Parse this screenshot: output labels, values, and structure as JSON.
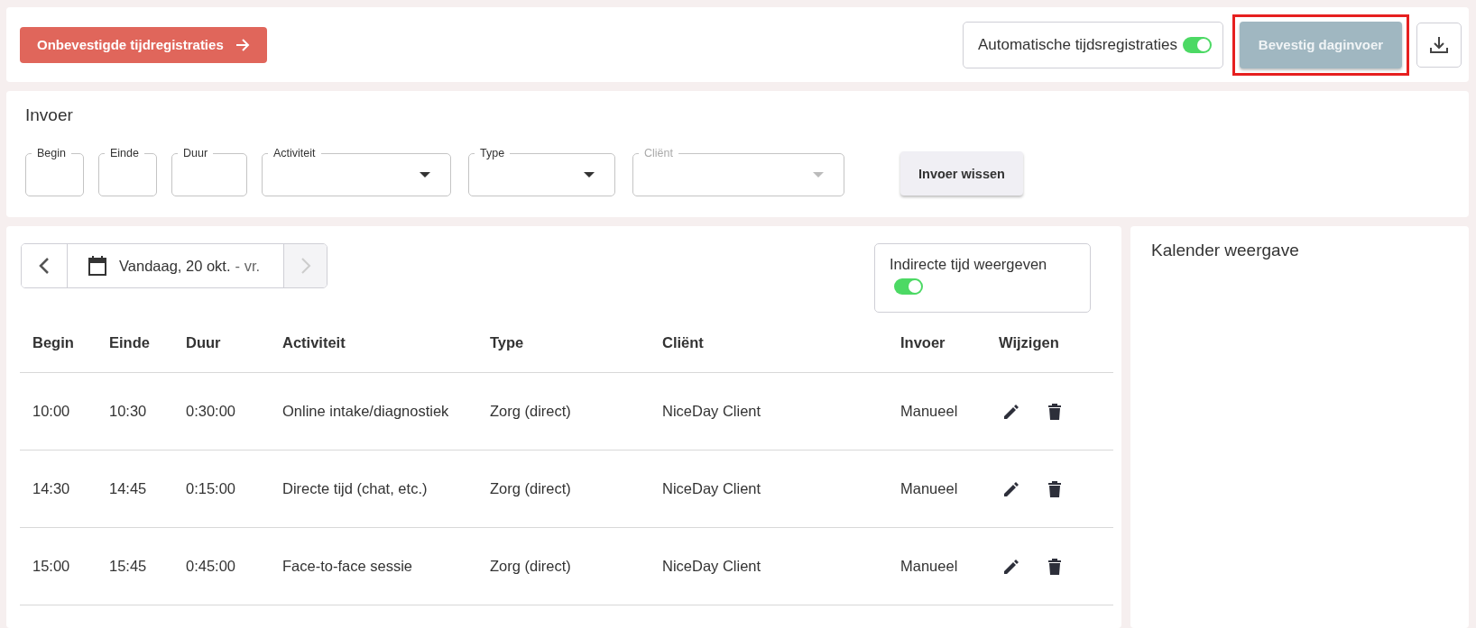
{
  "top_bar": {
    "unconfirmed_button": {
      "label": "Onbevestigde tijdregistraties"
    },
    "auto_toggle": {
      "label": "Automatische tijdsregistraties",
      "on": true
    },
    "confirm_button": {
      "label": "Bevestig daginvoer",
      "disabled": true,
      "highlighted": true
    }
  },
  "entry": {
    "title": "Invoer",
    "fields": [
      {
        "label": "Begin",
        "kind": "text",
        "disabled": false
      },
      {
        "label": "Einde",
        "kind": "text",
        "disabled": false
      },
      {
        "label": "Duur",
        "kind": "text",
        "disabled": false
      },
      {
        "label": "Activiteit",
        "kind": "select",
        "disabled": false
      },
      {
        "label": "Type",
        "kind": "select",
        "disabled": false
      },
      {
        "label": "Cliënt",
        "kind": "select",
        "disabled": true
      }
    ],
    "clear_button": {
      "label": "Invoer wissen"
    }
  },
  "day_nav": {
    "date": "Vandaag, 20 okt.",
    "weekday": "- vr.",
    "next_disabled": true
  },
  "indirect_toggle": {
    "label": "Indirecte tijd weergeven",
    "on": true
  },
  "table": {
    "columns": [
      "Begin",
      "Einde",
      "Duur",
      "Activiteit",
      "Type",
      "Cliënt",
      "Invoer",
      "Wijzigen"
    ],
    "rows": [
      {
        "cells": [
          "10:00",
          "10:30",
          "0:30:00",
          "Online intake/diagnostiek",
          "Zorg (direct)",
          "NiceDay Client",
          "Manueel"
        ]
      },
      {
        "cells": [
          "14:30",
          "14:45",
          "0:15:00",
          "Directe tijd (chat, etc.)",
          "Zorg (direct)",
          "NiceDay Client",
          "Manueel"
        ]
      },
      {
        "cells": [
          "15:00",
          "15:45",
          "0:45:00",
          "Face-to-face sessie",
          "Zorg (direct)",
          "NiceDay Client",
          "Manueel"
        ]
      }
    ]
  },
  "calendar": {
    "title": "Kalender weergave"
  }
}
